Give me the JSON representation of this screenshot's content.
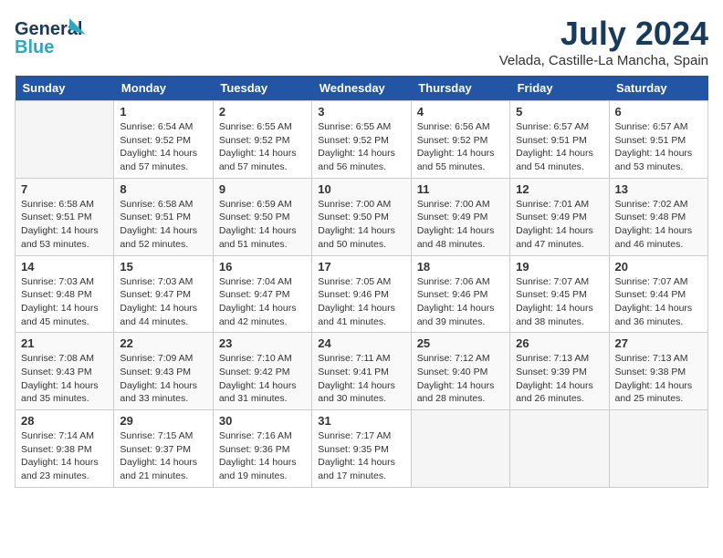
{
  "header": {
    "logo_line1": "General",
    "logo_line2": "Blue",
    "month": "July 2024",
    "location": "Velada, Castille-La Mancha, Spain"
  },
  "weekdays": [
    "Sunday",
    "Monday",
    "Tuesday",
    "Wednesday",
    "Thursday",
    "Friday",
    "Saturday"
  ],
  "weeks": [
    [
      {
        "num": "",
        "info": ""
      },
      {
        "num": "1",
        "info": "Sunrise: 6:54 AM\nSunset: 9:52 PM\nDaylight: 14 hours\nand 57 minutes."
      },
      {
        "num": "2",
        "info": "Sunrise: 6:55 AM\nSunset: 9:52 PM\nDaylight: 14 hours\nand 57 minutes."
      },
      {
        "num": "3",
        "info": "Sunrise: 6:55 AM\nSunset: 9:52 PM\nDaylight: 14 hours\nand 56 minutes."
      },
      {
        "num": "4",
        "info": "Sunrise: 6:56 AM\nSunset: 9:52 PM\nDaylight: 14 hours\nand 55 minutes."
      },
      {
        "num": "5",
        "info": "Sunrise: 6:57 AM\nSunset: 9:51 PM\nDaylight: 14 hours\nand 54 minutes."
      },
      {
        "num": "6",
        "info": "Sunrise: 6:57 AM\nSunset: 9:51 PM\nDaylight: 14 hours\nand 53 minutes."
      }
    ],
    [
      {
        "num": "7",
        "info": "Sunrise: 6:58 AM\nSunset: 9:51 PM\nDaylight: 14 hours\nand 53 minutes."
      },
      {
        "num": "8",
        "info": "Sunrise: 6:58 AM\nSunset: 9:51 PM\nDaylight: 14 hours\nand 52 minutes."
      },
      {
        "num": "9",
        "info": "Sunrise: 6:59 AM\nSunset: 9:50 PM\nDaylight: 14 hours\nand 51 minutes."
      },
      {
        "num": "10",
        "info": "Sunrise: 7:00 AM\nSunset: 9:50 PM\nDaylight: 14 hours\nand 50 minutes."
      },
      {
        "num": "11",
        "info": "Sunrise: 7:00 AM\nSunset: 9:49 PM\nDaylight: 14 hours\nand 48 minutes."
      },
      {
        "num": "12",
        "info": "Sunrise: 7:01 AM\nSunset: 9:49 PM\nDaylight: 14 hours\nand 47 minutes."
      },
      {
        "num": "13",
        "info": "Sunrise: 7:02 AM\nSunset: 9:48 PM\nDaylight: 14 hours\nand 46 minutes."
      }
    ],
    [
      {
        "num": "14",
        "info": "Sunrise: 7:03 AM\nSunset: 9:48 PM\nDaylight: 14 hours\nand 45 minutes."
      },
      {
        "num": "15",
        "info": "Sunrise: 7:03 AM\nSunset: 9:47 PM\nDaylight: 14 hours\nand 44 minutes."
      },
      {
        "num": "16",
        "info": "Sunrise: 7:04 AM\nSunset: 9:47 PM\nDaylight: 14 hours\nand 42 minutes."
      },
      {
        "num": "17",
        "info": "Sunrise: 7:05 AM\nSunset: 9:46 PM\nDaylight: 14 hours\nand 41 minutes."
      },
      {
        "num": "18",
        "info": "Sunrise: 7:06 AM\nSunset: 9:46 PM\nDaylight: 14 hours\nand 39 minutes."
      },
      {
        "num": "19",
        "info": "Sunrise: 7:07 AM\nSunset: 9:45 PM\nDaylight: 14 hours\nand 38 minutes."
      },
      {
        "num": "20",
        "info": "Sunrise: 7:07 AM\nSunset: 9:44 PM\nDaylight: 14 hours\nand 36 minutes."
      }
    ],
    [
      {
        "num": "21",
        "info": "Sunrise: 7:08 AM\nSunset: 9:43 PM\nDaylight: 14 hours\nand 35 minutes."
      },
      {
        "num": "22",
        "info": "Sunrise: 7:09 AM\nSunset: 9:43 PM\nDaylight: 14 hours\nand 33 minutes."
      },
      {
        "num": "23",
        "info": "Sunrise: 7:10 AM\nSunset: 9:42 PM\nDaylight: 14 hours\nand 31 minutes."
      },
      {
        "num": "24",
        "info": "Sunrise: 7:11 AM\nSunset: 9:41 PM\nDaylight: 14 hours\nand 30 minutes."
      },
      {
        "num": "25",
        "info": "Sunrise: 7:12 AM\nSunset: 9:40 PM\nDaylight: 14 hours\nand 28 minutes."
      },
      {
        "num": "26",
        "info": "Sunrise: 7:13 AM\nSunset: 9:39 PM\nDaylight: 14 hours\nand 26 minutes."
      },
      {
        "num": "27",
        "info": "Sunrise: 7:13 AM\nSunset: 9:38 PM\nDaylight: 14 hours\nand 25 minutes."
      }
    ],
    [
      {
        "num": "28",
        "info": "Sunrise: 7:14 AM\nSunset: 9:38 PM\nDaylight: 14 hours\nand 23 minutes."
      },
      {
        "num": "29",
        "info": "Sunrise: 7:15 AM\nSunset: 9:37 PM\nDaylight: 14 hours\nand 21 minutes."
      },
      {
        "num": "30",
        "info": "Sunrise: 7:16 AM\nSunset: 9:36 PM\nDaylight: 14 hours\nand 19 minutes."
      },
      {
        "num": "31",
        "info": "Sunrise: 7:17 AM\nSunset: 9:35 PM\nDaylight: 14 hours\nand 17 minutes."
      },
      {
        "num": "",
        "info": ""
      },
      {
        "num": "",
        "info": ""
      },
      {
        "num": "",
        "info": ""
      }
    ]
  ]
}
